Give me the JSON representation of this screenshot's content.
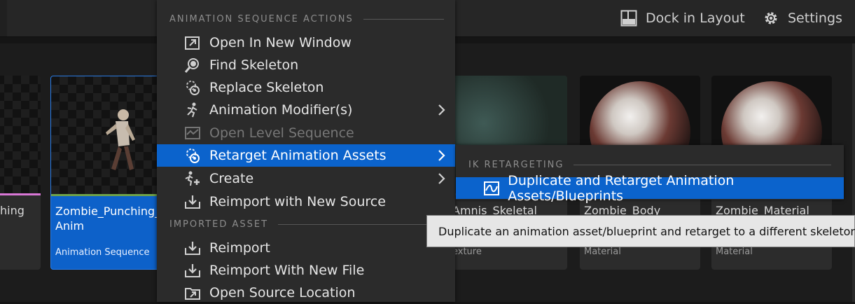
{
  "topbar": {
    "dock_label": "Dock in Layout",
    "settings_label": "Settings"
  },
  "tiles": {
    "prev": {
      "name": "hing"
    },
    "zombie": {
      "name": "Zombie_Punching_\nAnim",
      "type": "Animation Sequence"
    },
    "texture": {
      "name": "Amnis_Skeletal",
      "type": "exture"
    },
    "material1": {
      "name": "Zombie_Body",
      "type": "Material"
    },
    "material2": {
      "name": "Zombie_Material",
      "type": "Material"
    }
  },
  "menu": {
    "section1": "ANIMATION SEQUENCE ACTIONS",
    "section2": "IMPORTED ASSET",
    "items": [
      {
        "label": "Open In New Window",
        "icon": "open-window-icon"
      },
      {
        "label": "Find Skeleton",
        "icon": "find-skeleton-icon"
      },
      {
        "label": "Replace Skeleton",
        "icon": "replace-skeleton-icon"
      },
      {
        "label": "Animation Modifier(s)",
        "icon": "animation-modifier-icon"
      },
      {
        "label": "Open Level Sequence",
        "icon": "level-sequence-icon"
      },
      {
        "label": "Retarget Animation Assets",
        "icon": "retarget-icon"
      },
      {
        "label": "Create",
        "icon": "create-icon"
      },
      {
        "label": "Reimport with New Source",
        "icon": "reimport-icon"
      },
      {
        "label": "Reimport",
        "icon": "reimport-icon"
      },
      {
        "label": "Reimport With New File",
        "icon": "reimport-icon"
      },
      {
        "label": "Open Source Location",
        "icon": "folder-icon"
      }
    ]
  },
  "submenu": {
    "section": "IK RETARGETING",
    "item_label": "Duplicate and Retarget Animation Assets/Blueprints"
  },
  "tooltip": {
    "text": "Duplicate an animation asset/blueprint and retarget to a different skeleton."
  },
  "colors": {
    "highlight": "#0b63cc",
    "menu_bg": "#2b2b2b",
    "tooltip_bg": "#e6e6e6"
  }
}
